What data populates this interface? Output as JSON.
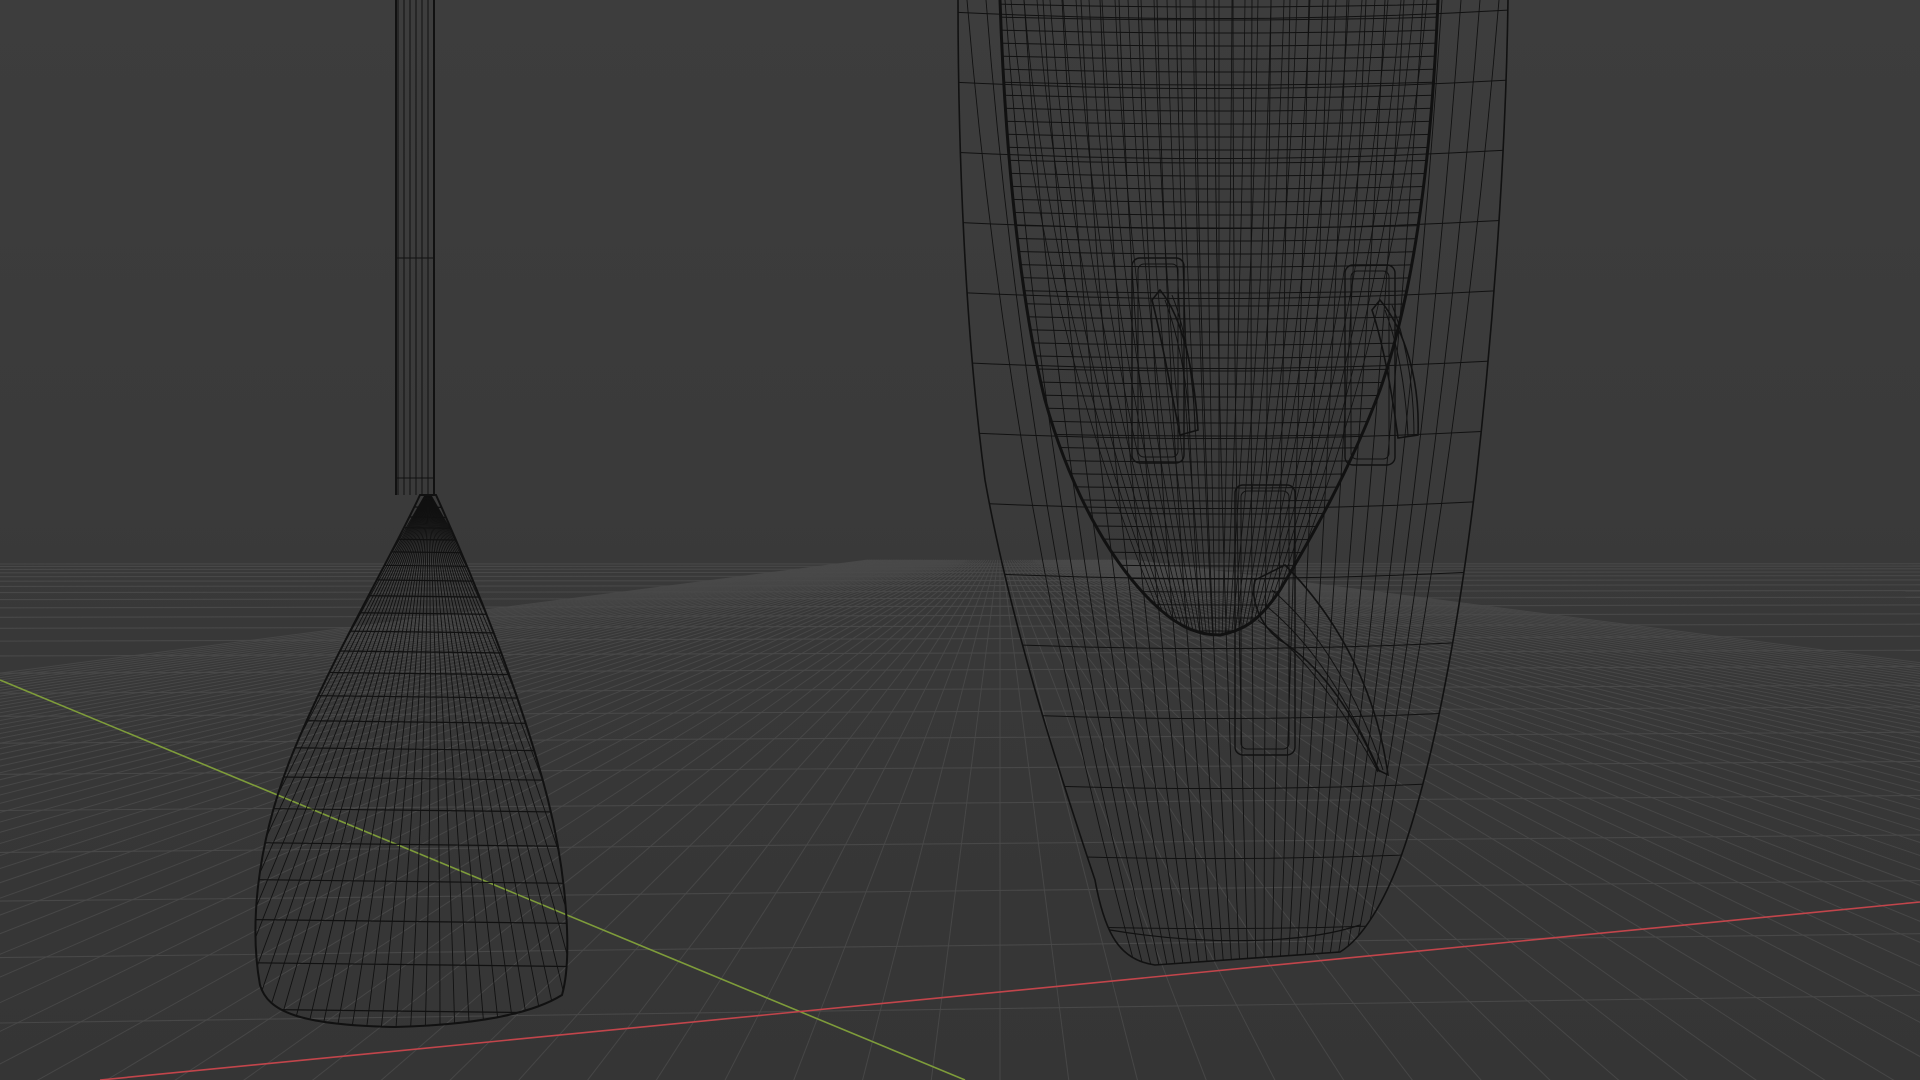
{
  "viewport": {
    "mode": "wireframe",
    "background_color": "#3b3b3b",
    "grid_color": "#4a4a4a",
    "x_axis_color": "#c2454b",
    "y_axis_color": "#7e9c3a",
    "wire_color": "#111111"
  },
  "objects": [
    {
      "name": "paddle"
    },
    {
      "name": "board"
    },
    {
      "name": "fin"
    }
  ]
}
